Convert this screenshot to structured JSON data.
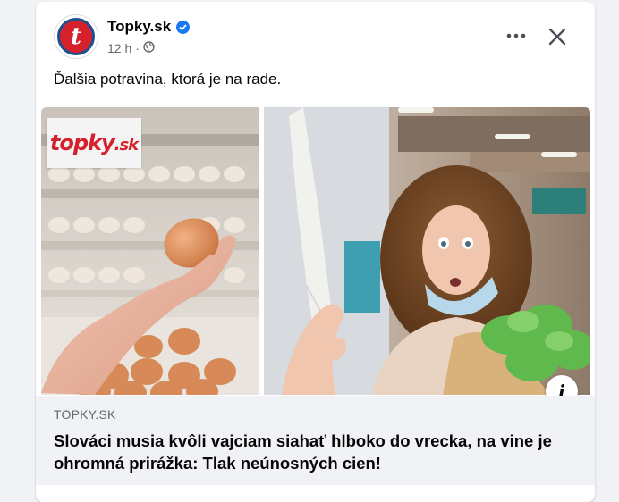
{
  "post": {
    "page_name": "Topky.sk",
    "avatar_letter": "t",
    "time": "12 h",
    "dot": "·",
    "text": "Ďalšia potravina, ktorá je na rade."
  },
  "image_logo": {
    "part1": "topky",
    "part2": ".sk"
  },
  "link": {
    "domain": "TOPKY.SK",
    "headline": "Slováci musia kvôli vajciam siahať hlboko do vrecka, na vine je ohromná prirážka: Tlak neúnosných cien!"
  },
  "info_icon_glyph": "i",
  "icons": {
    "verified": "verified-badge-icon",
    "audience": "globe-icon",
    "more": "more-options-icon",
    "close": "close-icon",
    "info": "info-icon"
  },
  "colors": {
    "brand_red": "#d5212b",
    "verified_blue": "#1877f2",
    "secondary_text": "#65676b",
    "link_bg": "#f0f2f5"
  }
}
